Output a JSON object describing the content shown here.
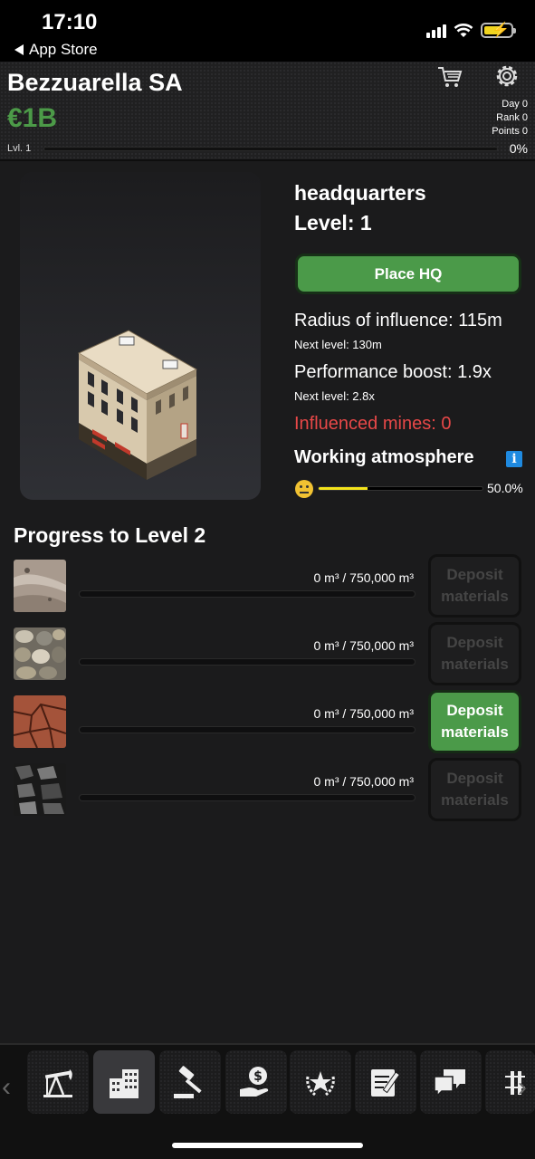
{
  "status_bar": {
    "time": "17:10",
    "back_label": "App Store"
  },
  "header": {
    "company_name": "Bezzuarella SA",
    "money": "€1B",
    "day": "Day 0",
    "rank": "Rank 0",
    "points": "Points 0",
    "level_label": "Lvl. 1",
    "level_progress": "0%"
  },
  "building": {
    "name": "headquarters",
    "level": "Level: 1",
    "place_button": "Place HQ",
    "radius": "Radius of influence: 115m",
    "radius_next": "Next level: 130m",
    "boost": "Performance boost: 1.9x",
    "boost_next": "Next level: 2.8x",
    "influenced_mines": "Influenced mines: 0",
    "atmosphere_title": "Working atmosphere",
    "atmosphere_pct": "50.0%",
    "atmosphere_fraction": 0.5
  },
  "progress": {
    "title": "Progress to Level 2",
    "materials": [
      {
        "name": "sand",
        "amount": "0 m³ / 750,000 m³",
        "deposit_label_1": "Deposit",
        "deposit_label_2": "materials",
        "enabled": false
      },
      {
        "name": "gravel",
        "amount": "0 m³ / 750,000 m³",
        "deposit_label_1": "Deposit",
        "deposit_label_2": "materials",
        "enabled": false
      },
      {
        "name": "clay",
        "amount": "0 m³ / 750,000 m³",
        "deposit_label_1": "Deposit",
        "deposit_label_2": "materials",
        "enabled": true
      },
      {
        "name": "coal",
        "amount": "0 m³ / 750,000 m³",
        "deposit_label_1": "Deposit",
        "deposit_label_2": "materials",
        "enabled": false
      }
    ]
  },
  "nav": {
    "items": [
      "oil-pump-icon",
      "buildings-icon",
      "auction-gavel-icon",
      "money-hand-icon",
      "laurel-star-icon",
      "notepad-icon",
      "chat-icon",
      "more-icon"
    ],
    "active_index": 1
  },
  "colors": {
    "accent_green": "#4b9a49",
    "money_green": "#4c9a48",
    "warning_red": "#e84848",
    "atmosphere_yellow": "#f4e41a"
  }
}
